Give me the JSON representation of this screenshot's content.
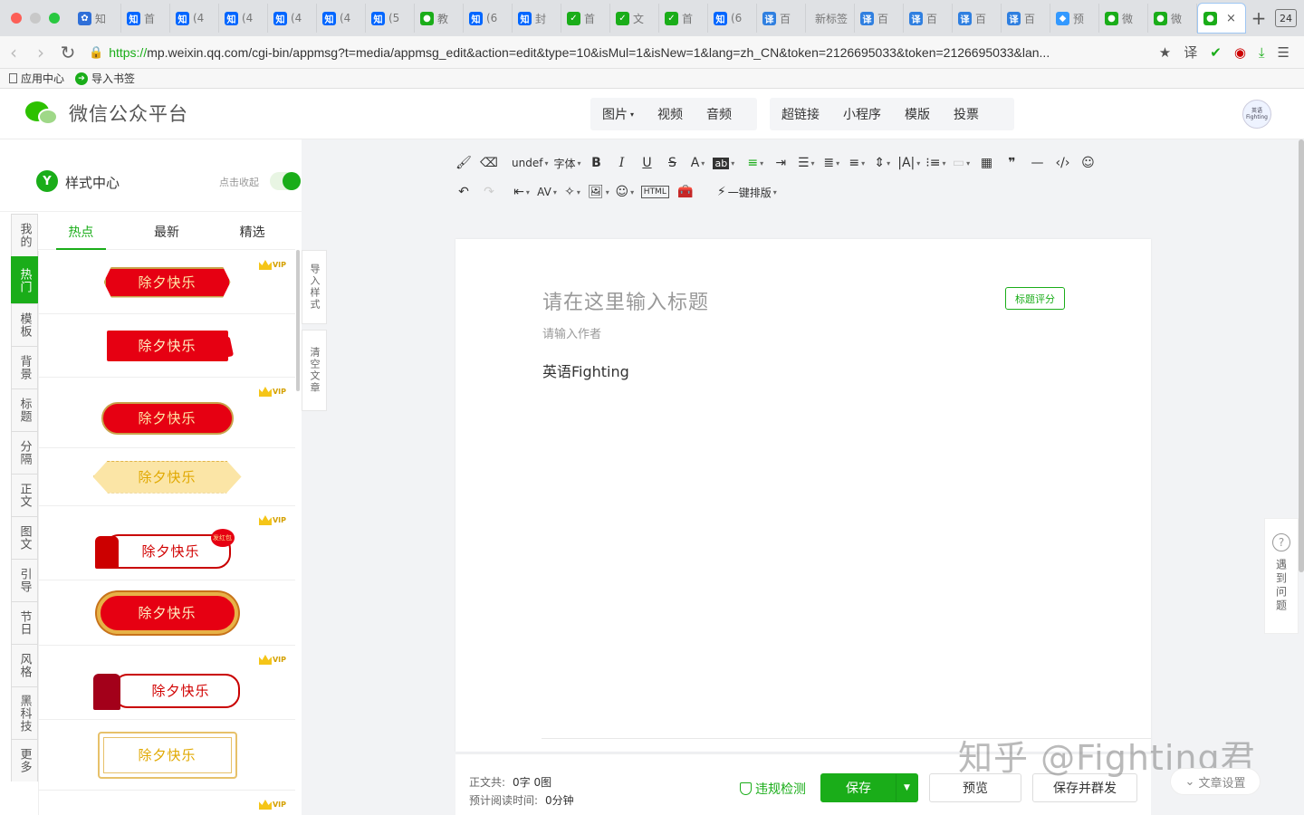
{
  "browser": {
    "tabs": [
      {
        "favicon": "baidu-paw-icon",
        "color": "#2f6fd8",
        "glyph": "✿",
        "label": "知"
      },
      {
        "favicon": "zhihu-icon",
        "color": "#0066ff",
        "glyph": "知",
        "label": "首"
      },
      {
        "favicon": "zhihu-icon",
        "color": "#0066ff",
        "glyph": "知",
        "label": "(4"
      },
      {
        "favicon": "zhihu-icon",
        "color": "#0066ff",
        "glyph": "知",
        "label": "(4"
      },
      {
        "favicon": "zhihu-icon",
        "color": "#0066ff",
        "glyph": "知",
        "label": "(4"
      },
      {
        "favicon": "zhihu-icon",
        "color": "#0066ff",
        "glyph": "知",
        "label": "(4"
      },
      {
        "favicon": "zhihu-icon",
        "color": "#0066ff",
        "glyph": "知",
        "label": "(5"
      },
      {
        "favicon": "wechat-icon",
        "color": "#1aad19",
        "glyph": "●",
        "label": "教"
      },
      {
        "favicon": "zhihu-icon",
        "color": "#0066ff",
        "glyph": "知",
        "label": "(6"
      },
      {
        "favicon": "zhihu-icon",
        "color": "#0066ff",
        "glyph": "知",
        "label": "封"
      },
      {
        "favicon": "135-editor-icon",
        "color": "#1aad19",
        "glyph": "✓",
        "label": "首"
      },
      {
        "favicon": "135-editor-icon",
        "color": "#1aad19",
        "glyph": "✓",
        "label": "文"
      },
      {
        "favicon": "135-editor-icon",
        "color": "#1aad19",
        "glyph": "✓",
        "label": "首"
      },
      {
        "favicon": "zhihu-icon",
        "color": "#0066ff",
        "glyph": "知",
        "label": "(6"
      },
      {
        "favicon": "translate-icon",
        "color": "#2f7fe0",
        "glyph": "译",
        "label": "百"
      },
      {
        "favicon": "none",
        "color": "#dfe1e4",
        "glyph": "",
        "label": "新标签"
      },
      {
        "favicon": "translate-icon",
        "color": "#2f7fe0",
        "glyph": "译",
        "label": "百"
      },
      {
        "favicon": "translate-icon",
        "color": "#2f7fe0",
        "glyph": "译",
        "label": "百"
      },
      {
        "favicon": "translate-icon",
        "color": "#2f7fe0",
        "glyph": "译",
        "label": "百"
      },
      {
        "favicon": "translate-icon",
        "color": "#2f7fe0",
        "glyph": "译",
        "label": "百"
      },
      {
        "favicon": "preview-icon",
        "color": "#3399ff",
        "glyph": "◆",
        "label": "预"
      },
      {
        "favicon": "wechat-icon",
        "color": "#1aad19",
        "glyph": "●",
        "label": "微"
      },
      {
        "favicon": "wechat-icon",
        "color": "#1aad19",
        "glyph": "●",
        "label": "微"
      }
    ],
    "active_tab_close": "×",
    "new_tab": "+",
    "tab_count": "24",
    "url_scheme": "https://",
    "url_rest": "mp.weixin.qq.com/cgi-bin/appmsg?t=media/appmsg_edit&action=edit&type=10&isMul=1&isNew=1&lang=zh_CN&token=2126695033&token=2126695033&lan...",
    "bookmarks": [
      {
        "icon": "document-icon",
        "label": "应用中心"
      },
      {
        "icon": "import-arrow-icon",
        "label": "导入书签"
      }
    ]
  },
  "header": {
    "logo_text": "微信公众平台",
    "insert_media": [
      "图片",
      "视频",
      "音频"
    ],
    "insert_media_caret": "▾",
    "insert_other": [
      "超链接",
      "小程序",
      "模版",
      "投票"
    ],
    "avatar_text": "英语 Fighting"
  },
  "style_center": {
    "logo_letter": "Y",
    "title": "样式中心",
    "collapse_label": "点击收起",
    "categories": [
      "我的",
      "热门",
      "模板",
      "背景",
      "标题",
      "分隔",
      "正文",
      "图文",
      "引导",
      "节日",
      "风格",
      "黑科技",
      "更多"
    ],
    "active_category": 1,
    "tabs": [
      "热点",
      "最新",
      "精选"
    ],
    "active_tab": 0,
    "vip_label": "VIP",
    "banner_text": "除夕快乐",
    "red_packet_text": "发红包",
    "side_actions": [
      "导入样式",
      "清空文章"
    ]
  },
  "toolbar": {
    "font_size": "undef",
    "font_family": "字体",
    "one_click_layout": "一键排版"
  },
  "editor": {
    "title_placeholder": "请在这里输入标题",
    "title_score": "标题评分",
    "author_placeholder": "请输入作者",
    "content": "英语Fighting"
  },
  "footer": {
    "word_count_label": "正文共:",
    "word_count_value": "0字 0图",
    "read_time_label": "预计阅读时间:",
    "read_time_value": "0分钟",
    "violation_check": "违规检测",
    "save": "保存",
    "preview": "预览",
    "save_and_send": "保存并群发"
  },
  "help": {
    "label": "遇到问题"
  },
  "article_settings": "文章设置",
  "watermark": "知乎 @Fighting君",
  "colors": {
    "accent": "#1aad19",
    "banner_red": "#e60012",
    "gold": "#e7c16a"
  }
}
